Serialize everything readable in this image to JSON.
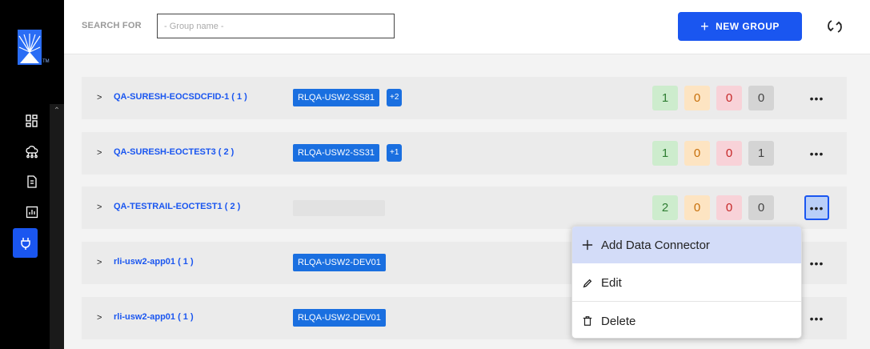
{
  "sidebar": {
    "nav": [
      {
        "icon": "dashboard-icon"
      },
      {
        "icon": "cloud-network-icon"
      },
      {
        "icon": "document-icon"
      },
      {
        "icon": "report-chart-icon"
      },
      {
        "icon": "plug-icon",
        "active": true
      }
    ]
  },
  "toolbar": {
    "search_label": "SEARCH FOR",
    "search_placeholder": "- Group name -",
    "search_value": "",
    "new_group_label": "NEW GROUP"
  },
  "groups": [
    {
      "name": "QA-SURESH-EOCSDCFID-1 ( 1 )",
      "tag": "RLQA-USW2-SS81",
      "extra": "+2",
      "counts": [
        "1",
        "0",
        "0",
        "0"
      ]
    },
    {
      "name": "QA-SURESH-EOCTEST3 ( 2 )",
      "tag": "RLQA-USW2-SS31",
      "extra": "+1",
      "counts": [
        "1",
        "0",
        "0",
        "1"
      ]
    },
    {
      "name": "QA-TESTRAIL-EOCTEST1 ( 2 )",
      "tag": "",
      "extra": "",
      "counts": [
        "2",
        "0",
        "0",
        "0"
      ]
    },
    {
      "name": "rli-usw2-app01 ( 1 )",
      "tag": "RLQA-USW2-DEV01",
      "extra": "",
      "counts": []
    },
    {
      "name": "rli-usw2-app01 ( 1 )",
      "tag": "RLQA-USW2-DEV01",
      "extra": "",
      "counts": []
    }
  ],
  "context_menu": {
    "items": [
      {
        "label": "Add Data Connector",
        "icon": "plus-icon"
      },
      {
        "label": "Edit",
        "icon": "pencil-icon"
      },
      {
        "label": "Delete",
        "icon": "trash-icon"
      }
    ]
  },
  "colors": {
    "accent": "#1a56f0",
    "tag": "#1a6fe0",
    "status_green": "#cdeccd",
    "status_orange": "#fde4c2",
    "status_red": "#f8d2d8",
    "status_grey": "#d4d4d4"
  }
}
